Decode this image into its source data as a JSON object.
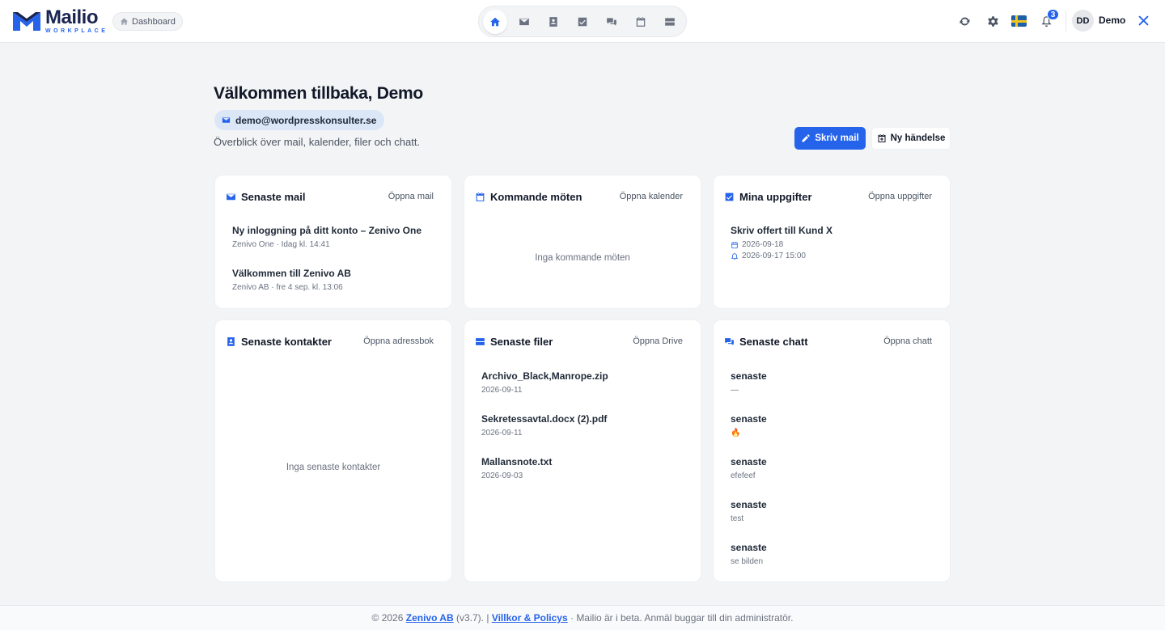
{
  "header": {
    "logo_name": "Mailio",
    "logo_sub": "WORKPLACE",
    "breadcrumb": "Dashboard",
    "nav": [
      "home-icon",
      "mail-icon",
      "contacts-icon",
      "tasks-icon",
      "chat-icon",
      "calendar-icon",
      "drive-icon"
    ],
    "notification_count": "3",
    "avatar_initials": "DD",
    "user_name": "Demo"
  },
  "welcome": {
    "title": "Välkommen tillbaka, Demo",
    "email": "demo@wordpresskonsulter.se",
    "subtitle": "Överblick över mail, kalender, filer och chatt.",
    "compose_label": "Skriv mail",
    "new_event_label": "Ny händelse"
  },
  "cards": {
    "mail": {
      "title": "Senaste mail",
      "link": "Öppna mail",
      "items": [
        {
          "title": "Ny inloggning på ditt konto – Zenivo One",
          "sub": "Zenivo One · Idag kl. 14:41"
        },
        {
          "title": "Välkommen till Zenivo AB",
          "sub": "Zenivo AB · fre 4 sep. kl. 13:06"
        }
      ]
    },
    "meetings": {
      "title": "Kommande möten",
      "link": "Öppna kalender",
      "empty": "Inga kommande möten"
    },
    "tasks": {
      "title": "Mina uppgifter",
      "link": "Öppna uppgifter",
      "items": [
        {
          "title": "Skriv offert till Kund X",
          "date": "2026-09-18",
          "reminder": "2026-09-17 15:00"
        }
      ]
    },
    "contacts": {
      "title": "Senaste kontakter",
      "link": "Öppna adressbok",
      "empty": "Inga senaste kontakter"
    },
    "files": {
      "title": "Senaste filer",
      "link": "Öppna Drive",
      "items": [
        {
          "title": "Archivo_Black,Manrope.zip",
          "sub": "2026-09-11"
        },
        {
          "title": "Sekretessavtal.docx (2).pdf",
          "sub": "2026-09-11"
        },
        {
          "title": "Mallansnote.txt",
          "sub": "2026-09-03"
        }
      ]
    },
    "chat": {
      "title": "Senaste chatt",
      "link": "Öppna chatt",
      "items": [
        {
          "title": "senaste",
          "sub": "—"
        },
        {
          "title": "senaste",
          "sub": "🔥"
        },
        {
          "title": "senaste",
          "sub": "efefeef"
        },
        {
          "title": "senaste",
          "sub": "test"
        },
        {
          "title": "senaste",
          "sub": "se bilden"
        }
      ]
    }
  },
  "footer": {
    "prefix": "© 2026",
    "company": "Zenivo AB",
    "version": "(v3.7). |",
    "terms": "Villkor & Policys",
    "suffix": "· Mailio är i beta. Anmäl buggar till din administratör."
  },
  "colors": {
    "accent": "#2563eb",
    "background": "#f3f4f6",
    "card": "#ffffff"
  }
}
